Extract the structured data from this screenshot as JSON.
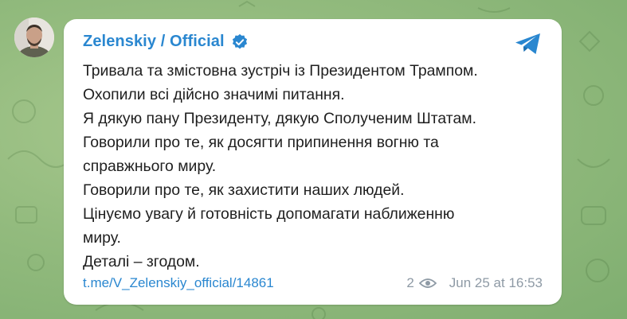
{
  "channel": {
    "name": "Zelenskiy / Official",
    "verified": true,
    "avatar_icon": "profile-photo"
  },
  "message": {
    "lines": [
      "Тривала та змістовна зустріч із Президентом Трампом.",
      "Охопили всі дійсно значимі питання.",
      "Я дякую пану Президенту, дякую Сполученим Штатам.",
      "Говорили про те, як досягти припинення вогню та",
      "справжнього миру.",
      "Говорили про те, як захистити наших людей.",
      "Цінуємо увагу й готовність допомагати наближенню",
      "миру.",
      "Деталі – згодом."
    ]
  },
  "footer": {
    "link": "t.me/V_Zelenskiy_official/14861",
    "views": "2",
    "timestamp": "Jun 25 at 16:53"
  },
  "colors": {
    "accent": "#2a87d0",
    "background": "#93bb7e",
    "meta": "#8e9aa5"
  },
  "icons": {
    "share": "telegram-plane-icon",
    "views": "eye-icon",
    "verified": "verified-badge-icon"
  }
}
